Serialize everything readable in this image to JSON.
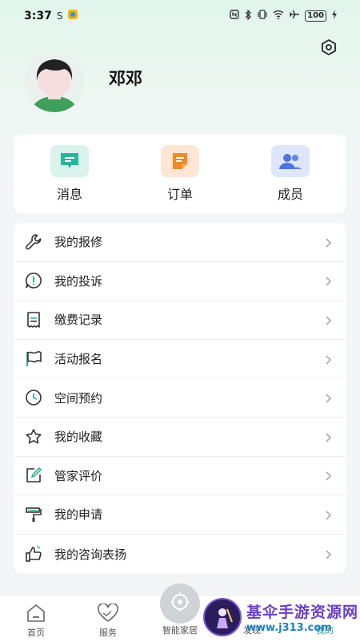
{
  "status_bar": {
    "time": "3:37",
    "icons": [
      "s-icon",
      "app-badge-icon",
      "nfc-icon",
      "bluetooth-icon",
      "vibrate-icon",
      "wifi-icon",
      "airplane-icon"
    ],
    "battery": "100"
  },
  "profile": {
    "nickname": "邓邓"
  },
  "quick_actions": [
    {
      "label": "消息",
      "icon": "message-icon",
      "color": "#29b59a"
    },
    {
      "label": "订单",
      "icon": "order-icon",
      "color": "#f08a24"
    },
    {
      "label": "成员",
      "icon": "members-icon",
      "color": "#4d74e0"
    }
  ],
  "menu": [
    {
      "label": "我的报修",
      "icon": "wrench-icon"
    },
    {
      "label": "我的投诉",
      "icon": "complaint-icon"
    },
    {
      "label": "缴费记录",
      "icon": "receipt-icon"
    },
    {
      "label": "活动报名",
      "icon": "flag-icon"
    },
    {
      "label": "空间预约",
      "icon": "clock-icon"
    },
    {
      "label": "我的收藏",
      "icon": "star-icon"
    },
    {
      "label": "管家评价",
      "icon": "edit-icon"
    },
    {
      "label": "我的申请",
      "icon": "paint-roller-icon"
    },
    {
      "label": "我的咨询表扬",
      "icon": "thumbs-up-icon"
    }
  ],
  "tabbar": {
    "home": "首页",
    "service": "服务",
    "smart_home": "智能家居",
    "discover": "发现",
    "mine": "我的"
  },
  "watermark": {
    "title": "基伞手游资源网",
    "url": "www.j313.com"
  },
  "colors": {
    "accent": "#29b59a",
    "icon_stroke": "#333333"
  }
}
